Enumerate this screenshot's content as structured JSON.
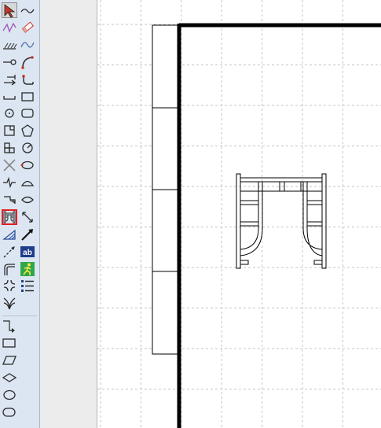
{
  "toolbar": {
    "tools": [
      {
        "name": "select-arrow-tool",
        "icon": "select-arrow-icon",
        "selected": true
      },
      {
        "name": "polyline-tool",
        "icon": "zigzag-line-icon"
      },
      {
        "name": "freehand-tool",
        "icon": "freehand-line-icon"
      },
      {
        "name": "eraser-tool",
        "icon": "eraser-icon"
      },
      {
        "name": "hatch-tool",
        "icon": "hatch-icon"
      },
      {
        "name": "spline-tool",
        "icon": "wave-curve-icon"
      },
      {
        "name": "line-end-tool",
        "icon": "line-endpoint-icon"
      },
      {
        "name": "arc-tool",
        "icon": "arc-icon"
      },
      {
        "name": "dimension-tool",
        "icon": "dimension-icon"
      },
      {
        "name": "u-curve-tool",
        "icon": "u-curve-icon"
      },
      {
        "name": "bracket-tool",
        "icon": "bracket-icon"
      },
      {
        "name": "rectangle-tool",
        "icon": "rectangle-icon"
      },
      {
        "name": "circle-center-tool",
        "icon": "circle-center-icon"
      },
      {
        "name": "rounded-rectangle-tool",
        "icon": "rounded-rectangle-icon"
      },
      {
        "name": "square-corner-tool",
        "icon": "square-corner-icon"
      },
      {
        "name": "polygon-tool",
        "icon": "pentagon-icon"
      },
      {
        "name": "group-shapes-tool",
        "icon": "group-squares-icon"
      },
      {
        "name": "gauge-tool",
        "icon": "gauge-circle-icon"
      },
      {
        "name": "cross-tool",
        "icon": "cross-lines-icon"
      },
      {
        "name": "ellipse-tool",
        "icon": "ellipse-icon"
      },
      {
        "name": "break-line-tool",
        "icon": "break-line-icon"
      },
      {
        "name": "half-ellipse-tool",
        "icon": "half-ellipse-icon"
      },
      {
        "name": "stair-tool",
        "icon": "stair-icon"
      },
      {
        "name": "leaf-shape-tool",
        "icon": "leaf-shape-icon"
      },
      {
        "name": "scaffold-tool",
        "icon": "scaffold-frame-icon",
        "highlighted": true
      },
      {
        "name": "diagonal-arrow-tool",
        "icon": "diagonal-arrows-icon"
      },
      {
        "name": "slope-tool",
        "icon": "slope-hatch-icon"
      },
      {
        "name": "arrow-line-tool",
        "icon": "arrow-line-icon"
      },
      {
        "name": "arrow-dashed-tool",
        "icon": "dashed-arrow-icon"
      },
      {
        "name": "text-tool",
        "icon": "text-ab-icon",
        "label": "ab"
      },
      {
        "name": "pipe-bend-tool",
        "icon": "pipe-bend-icon"
      },
      {
        "name": "person-tool",
        "icon": "running-person-icon"
      },
      {
        "name": "junction-tool",
        "icon": "four-curve-junction-icon"
      },
      {
        "name": "list-tool",
        "icon": "bullet-list-icon"
      },
      {
        "name": "branch-tool",
        "icon": "branch-junction-icon"
      },
      {
        "name": "connector-tool",
        "icon": "elbow-connector-icon"
      },
      {
        "name": "process-shape-tool",
        "icon": "process-rectangle-icon"
      },
      {
        "name": "data-shape-tool",
        "icon": "parallelogram-icon"
      },
      {
        "name": "decision-shape-tool",
        "icon": "diamond-icon"
      },
      {
        "name": "terminator-oval-tool",
        "icon": "oval-icon"
      },
      {
        "name": "terminator-rounded-tool",
        "icon": "rounded-terminator-icon"
      }
    ]
  },
  "colors": {
    "toolbar_bg": "#dce6f2",
    "highlight": "#e02020",
    "grid": "#c4c4c4",
    "wall": "#000000"
  }
}
